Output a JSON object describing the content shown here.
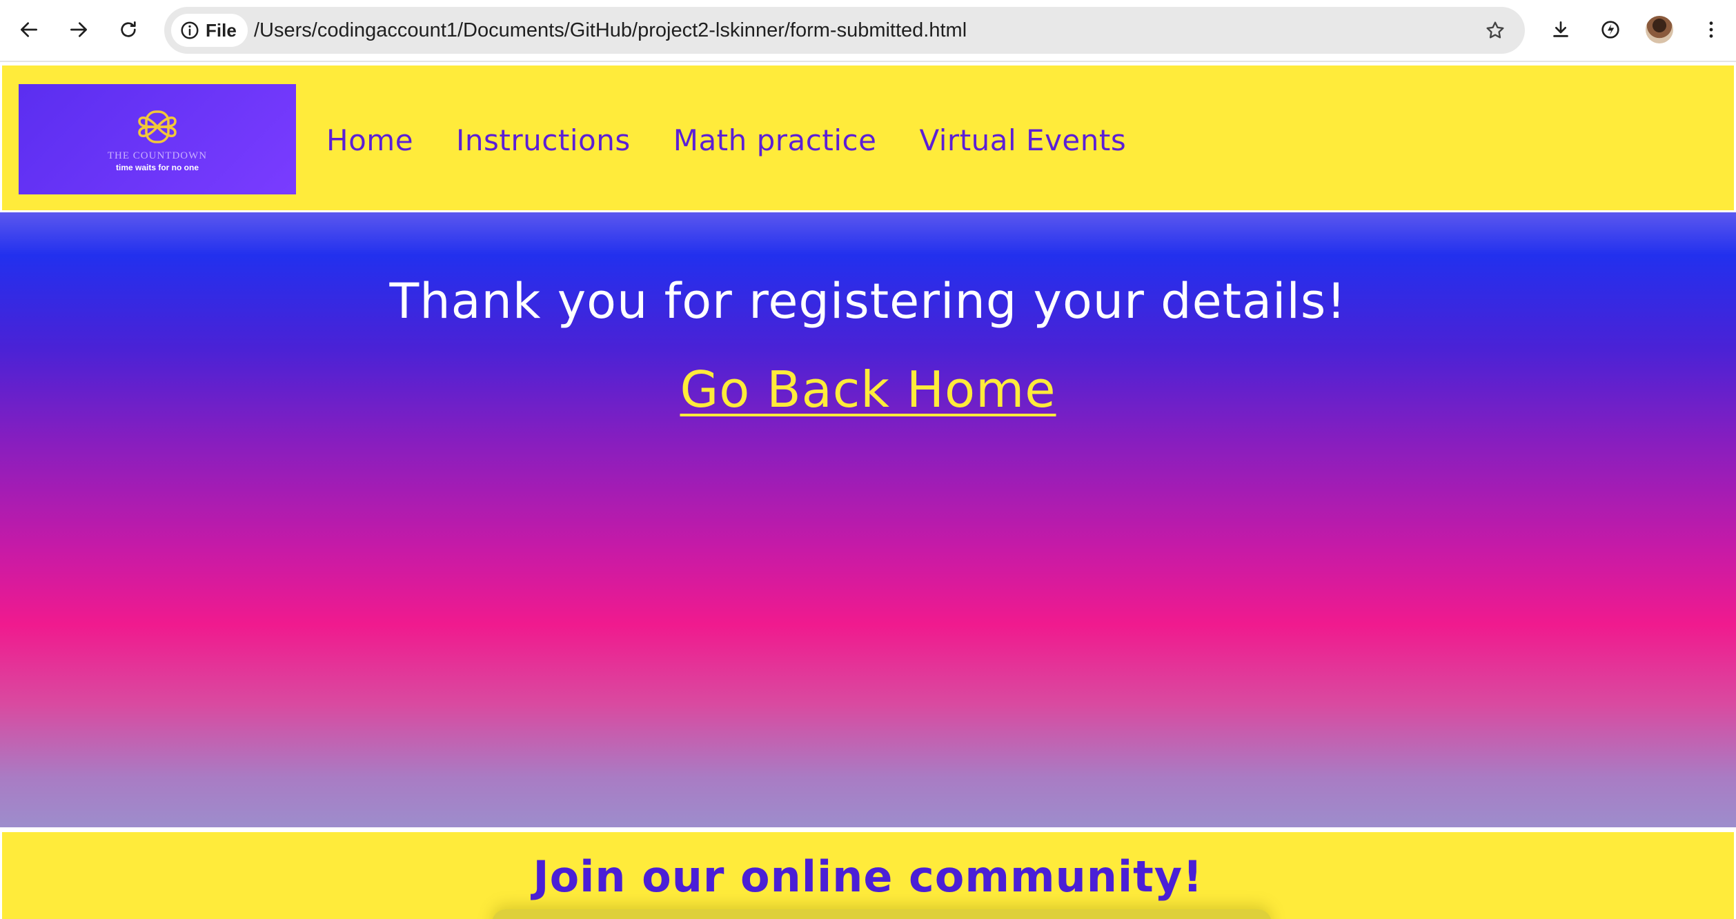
{
  "browser": {
    "site_chip_label": "File",
    "url": "/Users/codingaccount1/Documents/GitHub/project2-lskinner/form-submitted.html",
    "icons": [
      "back-arrow-icon",
      "forward-arrow-icon",
      "reload-icon",
      "info-icon",
      "star-icon",
      "download-icon",
      "performance-icon",
      "profile-avatar",
      "kebab-menu-icon"
    ]
  },
  "header": {
    "logo": {
      "title": "THE COUNTDOWN",
      "tagline": "time waits for no one"
    },
    "nav": [
      {
        "label": "Home"
      },
      {
        "label": "Instructions"
      },
      {
        "label": "Math practice"
      },
      {
        "label": "Virtual Events"
      }
    ]
  },
  "hero": {
    "heading": "Thank you for registering your details!",
    "home_link": "Go Back Home"
  },
  "footer": {
    "heading": "Join our online community!"
  },
  "colors": {
    "header_bg": "#ffeb3b",
    "nav_text": "#5b1fd6",
    "link_yellow": "#ffeb3b",
    "gradient_top": "#2230ee",
    "gradient_mid": "#f01a8e",
    "gradient_bottom": "#9d8dcc"
  }
}
